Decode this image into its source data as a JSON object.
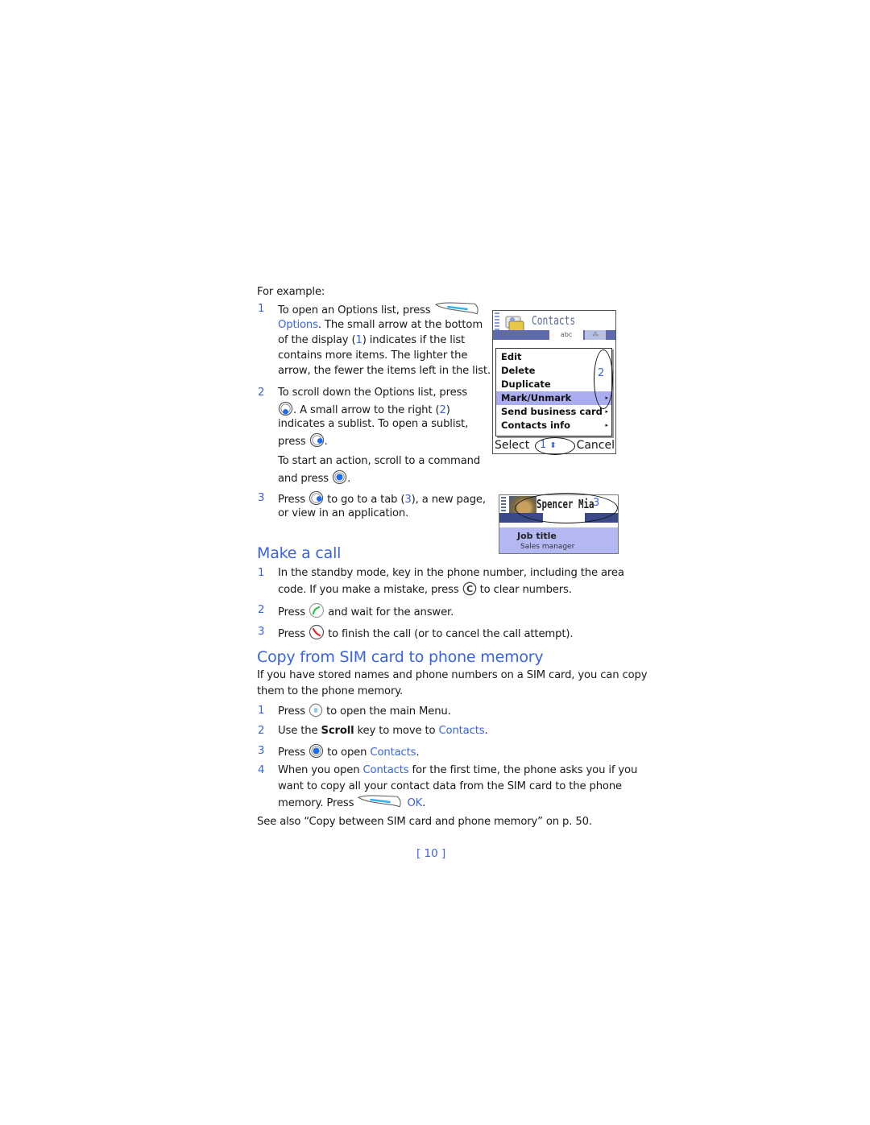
{
  "intro": "For example:",
  "options_steps": [
    {
      "num": "1",
      "lines": [
        "To open an Options list, press",
        "Options",
        ". The small arrow at the bottom",
        "of the display (",
        "1",
        ") indicates if the list",
        "contains more items. The lighter the",
        "arrow, the fewer the items left in the list."
      ]
    },
    {
      "num": "2",
      "lines": [
        "To scroll down the Options list, press",
        ". A small arrow to the right (",
        "2",
        ")",
        "indicates a sublist. To open a sublist,",
        "press",
        "."
      ]
    },
    {
      "extra": [
        "To start an action, scroll to a command",
        "and press",
        "."
      ]
    },
    {
      "num": "3",
      "lines": [
        "Press",
        "to go to a tab (",
        "3",
        "), a new page,",
        "or view in an application."
      ]
    }
  ],
  "screen1": {
    "title": "Contacts",
    "tab_label": "abc",
    "menu_items": [
      {
        "label": "Edit",
        "submenu": false,
        "selected": false
      },
      {
        "label": "Delete",
        "submenu": false,
        "selected": false
      },
      {
        "label": "Duplicate",
        "submenu": false,
        "selected": false
      },
      {
        "label": "Mark/Unmark",
        "submenu": true,
        "selected": true
      },
      {
        "label": "Send business card",
        "submenu": true,
        "selected": false
      },
      {
        "label": "Contacts info",
        "submenu": true,
        "selected": false
      }
    ],
    "left_softkey": "Select",
    "right_softkey": "Cancel",
    "callout_1": "1",
    "callout_2": "2",
    "arrow_glyph": "▸"
  },
  "screen2": {
    "name": "Spencer Mia",
    "field_label": "Job title",
    "field_value": "Sales manager",
    "callout_3": "3"
  },
  "make_call": {
    "heading": "Make a call",
    "steps": [
      {
        "num": "1",
        "l1": "In the standby mode, key in the phone number, including the area",
        "l2a": "code. If you make a mistake, press",
        "l2b": "to clear numbers."
      },
      {
        "num": "2",
        "a": "Press",
        "b": "and wait for the answer."
      },
      {
        "num": "3",
        "a": "Press",
        "b": "to finish the call (or to cancel the call attempt)."
      }
    ]
  },
  "copy_sim": {
    "heading": "Copy from SIM card to phone memory",
    "intro_l1": "If you have stored names and phone numbers on a SIM card, you can copy",
    "intro_l2": "them to the phone memory.",
    "steps": [
      {
        "num": "1",
        "a": "Press",
        "b": "to open the main Menu."
      },
      {
        "num": "2",
        "a": "Use the ",
        "bold": "Scroll",
        "b": " key to move to ",
        "link": "Contacts",
        "c": "."
      },
      {
        "num": "3",
        "a": "Press",
        "b": "to open ",
        "link": "Contacts",
        "c": "."
      },
      {
        "num": "4",
        "a": "When you open ",
        "link": "Contacts",
        "b": " for the first time, the phone asks you if you",
        "l2": "want to copy all your contact data from the SIM card to the phone",
        "l3a": "memory. Press",
        "l3b": "OK",
        "l3c": "."
      }
    ],
    "see_also": "See also “Copy between SIM card and phone memory” on p. 50."
  },
  "page_number": "[ 10 ]",
  "colors": {
    "accent": "#3a63e0",
    "menu_selected": "#a9adf0",
    "tab_bar": "#5f6aa8"
  }
}
